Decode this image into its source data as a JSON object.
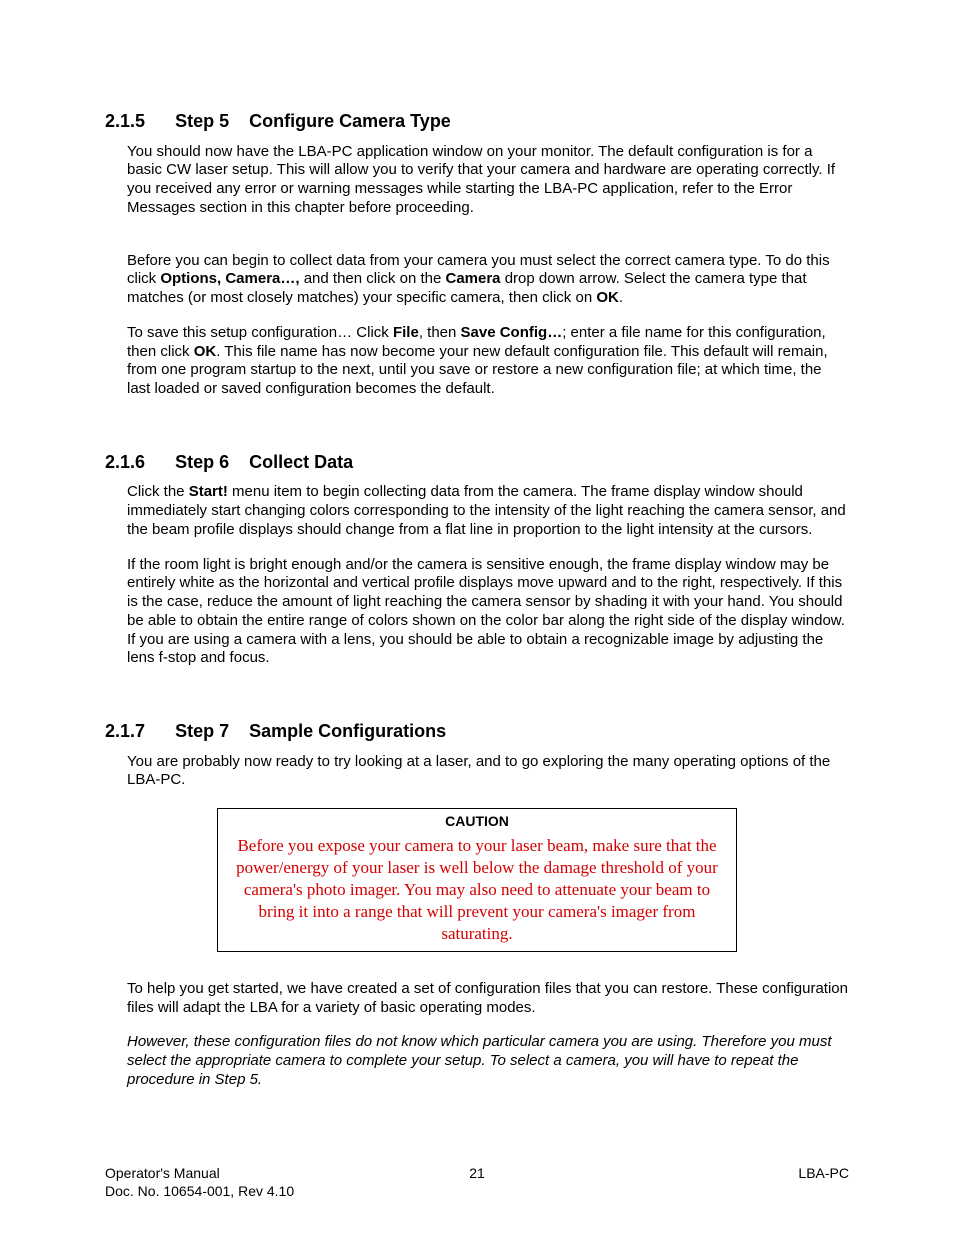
{
  "s215": {
    "num": "2.1.5",
    "step": "Step 5",
    "title": "Configure Camera Type",
    "p1": "You should now have the LBA-PC application window on your monitor.  The default configuration is for a basic CW laser setup.  This will allow you to verify that your camera and hardware are operating correctly.  If you received any error or warning messages while starting the LBA-PC application, refer to the Error Messages section in this chapter before proceeding.",
    "p2_pre": "Before you can begin to collect data from your camera you must select the correct camera type.  To do this click ",
    "p2_b1": "Options, Camera…,",
    "p2_mid1": " and then click on the ",
    "p2_b2": "Camera",
    "p2_mid2": " drop down arrow.  Select the camera type that matches (or most closely matches) your specific camera, then click on ",
    "p2_b3": "OK",
    "p2_end": ".",
    "p3_pre": "To save this setup configuration…  Click ",
    "p3_b1": "File",
    "p3_mid1": ", then ",
    "p3_b2": "Save Config…",
    "p3_mid2": "; enter a file name for this configuration, then click ",
    "p3_b3": "OK",
    "p3_end": ".  This file name has now become your new default configuration file.  This default will remain, from one program startup to the next, until you save or restore a new configuration file; at which time, the last loaded or saved configuration becomes the default."
  },
  "s216": {
    "num": "2.1.6",
    "step": "Step 6",
    "title": "Collect Data",
    "p1_pre": "Click the ",
    "p1_b1": "Start!",
    "p1_end": " menu item to begin collecting data from the camera.  The frame display window should immediately start changing colors corresponding to the intensity of the light reaching the camera sensor, and the beam profile displays should change from a flat line in proportion to the light intensity at the cursors.",
    "p2": "If the room light is bright enough and/or the camera is sensitive enough, the frame display window may be entirely white as the horizontal and vertical profile displays move upward and to the right, respectively.  If this is the case, reduce the amount of light reaching the camera sensor by shading it with your hand.  You should be able to obtain the entire range of colors shown on the color bar along the right side of the display window.  If you are using a camera with a lens, you should be able to obtain a recognizable image by adjusting the lens f-stop and focus."
  },
  "s217": {
    "num": "2.1.7",
    "step": "Step 7",
    "title": "Sample Configurations",
    "p1": "You are probably now ready to try looking at a laser, and to go exploring the many operating options of the LBA-PC.",
    "caution_title": "CAUTION",
    "caution_body": "Before you expose your camera to your laser beam, make sure that the power/energy of your laser is well below the damage threshold of your camera's photo imager.  You may also need to attenuate your beam to bring it into a range that will prevent your camera's imager from saturating.",
    "p2": "To help you get started, we have created a set of configuration files that you can restore.  These configuration files will adapt the LBA for a variety of basic operating modes.",
    "p3": "However, these configuration files do not know which particular camera you are using.  Therefore you must select the appropriate camera to complete your setup.  To select a camera, you will have to repeat the procedure in Step 5."
  },
  "footer": {
    "manual": "Operator's Manual",
    "docno": "Doc. No. 10654-001, Rev 4.10",
    "pageno": "21",
    "product": "LBA-PC"
  }
}
